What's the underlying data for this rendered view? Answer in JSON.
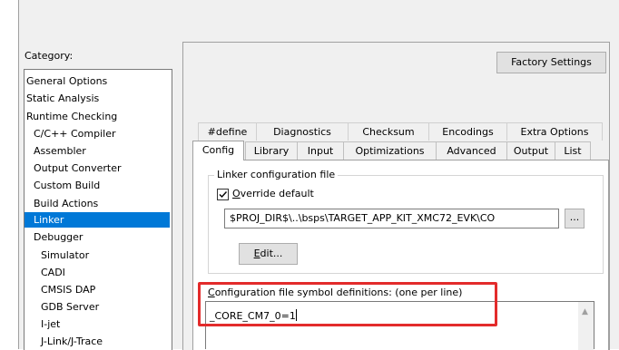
{
  "category": {
    "label": "Category:",
    "items": [
      {
        "label": "General Options",
        "level": 0
      },
      {
        "label": "Static Analysis",
        "level": 0
      },
      {
        "label": "Runtime Checking",
        "level": 0
      },
      {
        "label": "C/C++ Compiler",
        "level": 1
      },
      {
        "label": "Assembler",
        "level": 1
      },
      {
        "label": "Output Converter",
        "level": 1
      },
      {
        "label": "Custom Build",
        "level": 1
      },
      {
        "label": "Build Actions",
        "level": 1
      },
      {
        "label": "Linker",
        "level": 1,
        "selected": true
      },
      {
        "label": "Debugger",
        "level": 1
      },
      {
        "label": "Simulator",
        "level": 2
      },
      {
        "label": "CADI",
        "level": 2
      },
      {
        "label": "CMSIS DAP",
        "level": 2
      },
      {
        "label": "GDB Server",
        "level": 2
      },
      {
        "label": "I-jet",
        "level": 2
      },
      {
        "label": "J-Link/J-Trace",
        "level": 2
      }
    ]
  },
  "factory_settings_label": "Factory Settings",
  "tabs_back": [
    "#define",
    "Diagnostics",
    "Checksum",
    "Encodings",
    "Extra Options"
  ],
  "tabs_front": [
    "Config",
    "Library",
    "Input",
    "Optimizations",
    "Advanced",
    "Output",
    "List"
  ],
  "active_tab": "Config",
  "config": {
    "group_title": "Linker configuration file",
    "override_checked": true,
    "override_label_ul": "O",
    "override_label_rest": "verride default",
    "path_value": "$PROJ_DIR$\\..\\bsps\\TARGET_APP_KIT_XMC72_EVK\\CO",
    "browse_label": "...",
    "edit_label_ul": "E",
    "edit_label_rest": "dit...",
    "symbols_label_ul": "C",
    "symbols_label_rest": "onfiguration file symbol definitions: (one per line)",
    "symbols_value": "_CORE_CM7_0=1"
  },
  "colors": {
    "selection": "#0078d7",
    "highlight": "#e32b2b"
  }
}
